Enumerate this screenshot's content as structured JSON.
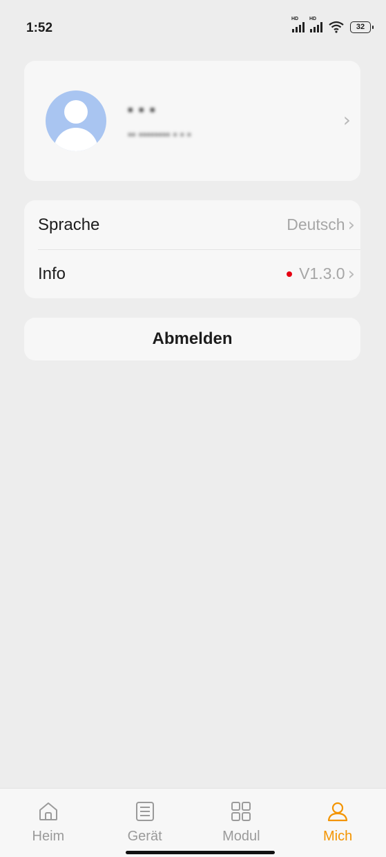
{
  "status_bar": {
    "time": "1:52",
    "hd1": "HD",
    "hd2": "HD",
    "battery": "32"
  },
  "profile": {
    "name": "▪ ▪ ▪",
    "subtitle": "▪▪ ▪▪▪▪▪▪▪▪ ▪ ▪ ▪",
    "avatar_icon": "user-avatar-icon",
    "chevron_icon": "chevron-right-icon",
    "redacted": true
  },
  "settings": {
    "language_label": "Sprache",
    "language_value": "Deutsch",
    "info_label": "Info",
    "info_value": "V1.3.0",
    "update_indicator_color": "#e60012"
  },
  "logout_label": "Abmelden",
  "tabs": [
    {
      "label": "Heim",
      "icon": "house-icon",
      "active": false
    },
    {
      "label": "Gerät",
      "icon": "list-icon",
      "active": false
    },
    {
      "label": "Modul",
      "icon": "grid-icon",
      "active": false
    },
    {
      "label": "Mich",
      "icon": "person-icon",
      "active": true
    }
  ],
  "colors": {
    "accent": "#f39400",
    "background": "#ededed",
    "card": "#f7f7f7",
    "avatar": "#a9c5f1"
  }
}
